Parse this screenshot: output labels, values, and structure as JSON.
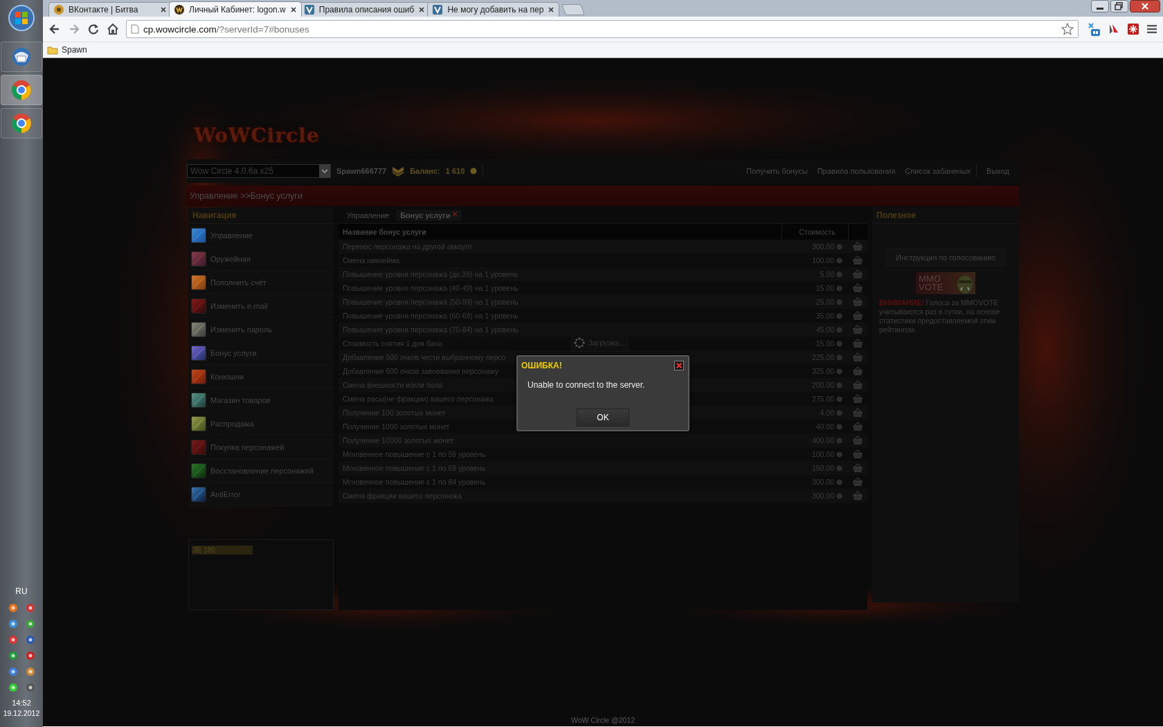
{
  "taskbar": {
    "apps": [
      {
        "kind": "mail"
      },
      {
        "kind": "browser"
      },
      {
        "kind": "browser"
      }
    ],
    "language": "RU",
    "time": "14:52",
    "date": "19.12.2012"
  },
  "browser": {
    "tabs": [
      {
        "title": "ВКонтакте | Битва",
        "selected": false
      },
      {
        "title": "Личный Кабинет: logon.w",
        "selected": true
      },
      {
        "title": "Правила описания ошиб",
        "selected": false
      },
      {
        "title": "Не могу добавить на пер",
        "selected": false
      }
    ],
    "address": {
      "host": "cp.wowcircle.com",
      "path": "/?serverId=7#bonuses"
    },
    "bookmarks": [
      "Spawn"
    ]
  },
  "site": {
    "logo": "WoWCircle",
    "server_select": "Wow Circle 4.0.6a x25",
    "username": "Spawn666777",
    "balance_label": "Баланс:",
    "balance": "1 610",
    "links": [
      "Получить бонусы",
      "Правила пользования",
      "Список забаненых",
      "Выход"
    ],
    "breadcrumb": "Управление >>Бонус услуги",
    "nav": {
      "title": "Навигация",
      "items": [
        "Управление",
        "Оружейная",
        "Пополнить счёт",
        "Изменить e-mail",
        "Изменить пароль",
        "Бонус услуги",
        "Конюшни",
        "Магазин товаров",
        "Распродажа",
        "Покупка персонажей",
        "Восстановление персонажей",
        "AntiError"
      ]
    },
    "counter": "3E 180",
    "content_tabs": [
      {
        "label": "Управление",
        "selected": false
      },
      {
        "label": "Бонус услуги",
        "selected": true
      }
    ],
    "table": {
      "columns": [
        "Название бонус услуги",
        "Стоимость"
      ],
      "rows": [
        {
          "name": "Перенос персонажа на другой аккаунт",
          "price": "300.00"
        },
        {
          "name": "Смена никнейма",
          "price": "100.00"
        },
        {
          "name": "Повышение уровня персонажа (до 39) на 1 уровень",
          "price": "5.00"
        },
        {
          "name": "Повышение уровня персонажа (40-49) на 1 уровень",
          "price": "15.00"
        },
        {
          "name": "Повышение уровня персонажа (50-59) на 1 уровень",
          "price": "25.00"
        },
        {
          "name": "Повышение уровня персонажа (60-69) на 1 уровень",
          "price": "35.00"
        },
        {
          "name": "Повышение уровня персонажа (70-84) на 1 уровень",
          "price": "45.00"
        },
        {
          "name": "Стоимость снятия 1 дня бана",
          "price": "15.00"
        },
        {
          "name": "Добавление 500 очков чести выбранному персо",
          "price": "225.00"
        },
        {
          "name": "Добавление 500 очков завоевания персонажу",
          "price": "325.00"
        },
        {
          "name": "Смена внешности и/или пола",
          "price": "200.00"
        },
        {
          "name": "Смена расы(не фракции) вашего персонажа",
          "price": "275.00"
        },
        {
          "name": "Получение 100 золотых монет",
          "price": "4.00"
        },
        {
          "name": "Получение 1000 золотых монет",
          "price": "40.00"
        },
        {
          "name": "Получение 10000 золотых монет",
          "price": "400.00"
        },
        {
          "name": "Мгновенное повышение с 1 по 59 уровень",
          "price": "100.00"
        },
        {
          "name": "Мгновенное повышение с 1 по 69 уровень",
          "price": "150.00"
        },
        {
          "name": "Мгновенное повышение с 1 по 84 уровень",
          "price": "300.00"
        },
        {
          "name": "Смена фракции вашего персонажа",
          "price": "300.00"
        }
      ]
    },
    "sidebar": {
      "title": "Полезное",
      "button": "Инструкция по голосованию",
      "banner": [
        "MMO",
        "VOTE"
      ],
      "notice_label": "ВНИМАНИЕ!",
      "notice": " Голоса за MMOVOTE учитываются раз в сутки, на основе статистики предоставляемой этим рейтингом."
    },
    "footer": "WoW Circle @2012"
  },
  "loading": "Загрузка...",
  "dialog": {
    "title": "ОШИБКА!",
    "message": "Unable to connect to the server.",
    "button": "OK"
  }
}
